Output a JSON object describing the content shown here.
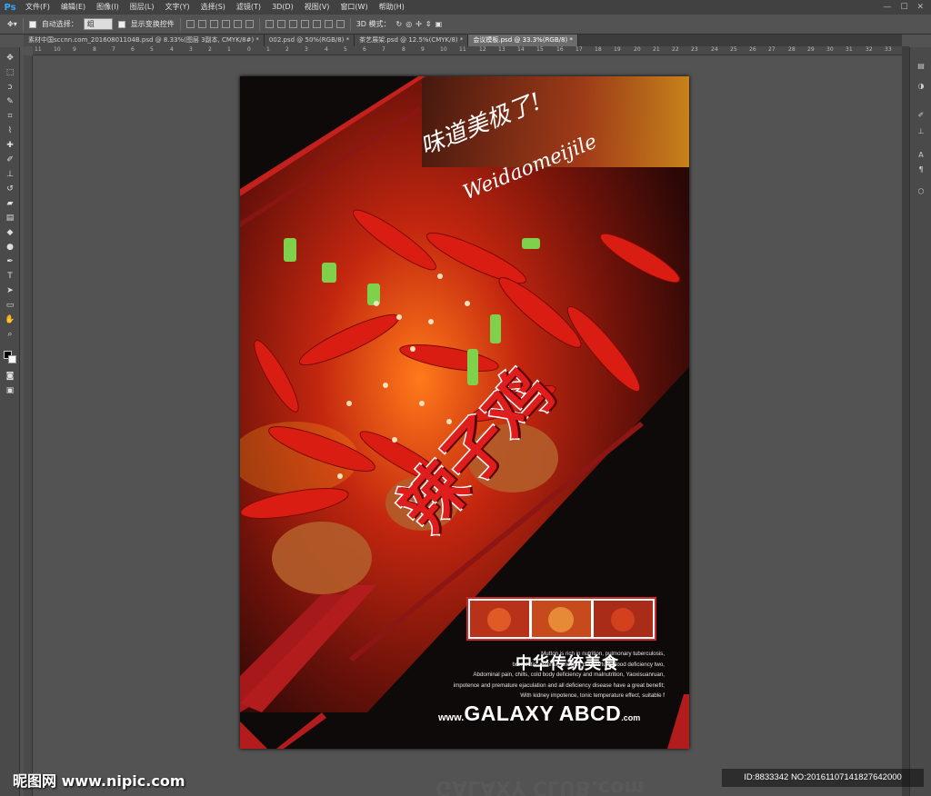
{
  "app": {
    "logo": "Ps",
    "menu": [
      "文件(F)",
      "编辑(E)",
      "图像(I)",
      "图层(L)",
      "文字(Y)",
      "选择(S)",
      "滤镜(T)",
      "3D(D)",
      "视图(V)",
      "窗口(W)",
      "帮助(H)"
    ],
    "window_controls": [
      "—",
      "☐",
      "✕"
    ]
  },
  "options": {
    "auto_select_label": "自动选择：",
    "auto_select_value": "组",
    "show_transform_label": "显示变换控件",
    "mode_3d_label": "3D 模式："
  },
  "tabs": [
    {
      "label": "素材中国sccnn.com_20160801104B.psd @ 8.33%(图层 3副本, CMYK/8#) *",
      "active": false
    },
    {
      "label": "002.psd @ 50%(RGB/8) *",
      "active": false
    },
    {
      "label": "茶艺展架.psd @ 12.5%(CMYK/8) *",
      "active": false
    },
    {
      "label": "会议模板.psd @ 33.3%(RGB/8) *",
      "active": true
    }
  ],
  "ruler_top": [
    "11",
    "10",
    "9",
    "8",
    "7",
    "6",
    "5",
    "4",
    "3",
    "2",
    "1",
    "0",
    "1",
    "2",
    "3",
    "4",
    "5",
    "6",
    "7",
    "8",
    "9",
    "10",
    "11",
    "12",
    "13",
    "14",
    "15",
    "16",
    "17",
    "18",
    "19",
    "20",
    "21",
    "22",
    "23",
    "24",
    "25",
    "26",
    "27",
    "28",
    "29",
    "30",
    "31",
    "32",
    "33"
  ],
  "poster": {
    "script_cn": "味道美极了!",
    "script_en": "Weidaomeijile",
    "title": "辣子鸡",
    "tagline": "中华传统美食",
    "description": [
      "Mutton is rich in nutrition, pulmonary tuberculosis,",
      "bronchitis, asthma, anemia, postpartum blood deficiency two,",
      "Abdominal pain, chills, cold body deficiency and malnutrition, Yaoxisuanruan,",
      "impotence and premature ejaculation and all deficiency disease have a great benefit;",
      "With kidney impotence, tonic temperature effect, suitable f"
    ],
    "site_prefix": "www.",
    "site_main": "GALAXY ABCD",
    "site_suffix": ".com",
    "reflection_text": "GALAXY CLUB.com",
    "accent_color": "#c92a2a"
  },
  "watermark": {
    "left": "昵图网 www.nipic.com",
    "right": "ID:8833342 NO:20161107141827642000"
  }
}
